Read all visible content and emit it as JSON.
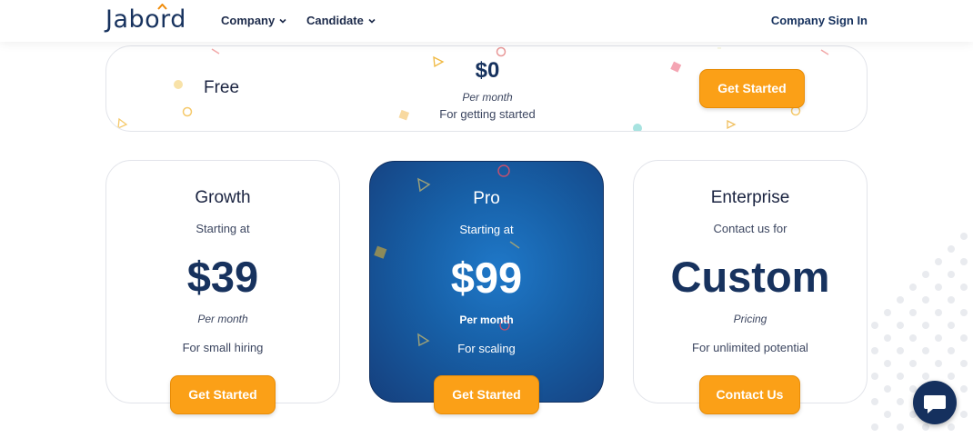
{
  "header": {
    "logo": "Jabord",
    "nav": [
      {
        "label": "Company"
      },
      {
        "label": "Candidate"
      }
    ],
    "signin": "Company Sign In"
  },
  "free": {
    "name": "Free",
    "price": "$0",
    "per": "Per month",
    "desc": "For getting started",
    "button": "Get Started"
  },
  "plans": [
    {
      "name": "Growth",
      "lead": "Starting at",
      "price": "$39",
      "per": "Per month",
      "desc": "For small hiring",
      "button": "Get Started"
    },
    {
      "name": "Pro",
      "lead": "Starting at",
      "price": "$99",
      "per": "Per month",
      "desc": "For scaling",
      "button": "Get Started"
    },
    {
      "name": "Enterprise",
      "lead": "Contact us for",
      "price": "Custom",
      "per": "Pricing",
      "desc": "For unlimited potential",
      "button": "Contact Us"
    }
  ],
  "colors": {
    "accent": "#fba017",
    "brand": "#17325e",
    "pro_card": "#175fa6"
  },
  "icons": {
    "nav_chevron": "chevron-down-icon",
    "chat": "chat-bubble-icon"
  }
}
